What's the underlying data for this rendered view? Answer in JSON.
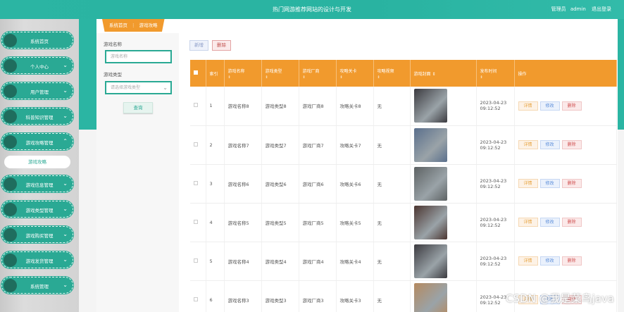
{
  "header": {
    "title": "热门网游推荐网站的设计与开发",
    "user_role": "管理员",
    "username": "admin",
    "logout": "退出登录"
  },
  "sidebar": {
    "items": [
      {
        "label": "系统首页",
        "chevron": ""
      },
      {
        "label": "个人中心",
        "chevron": "⌄"
      },
      {
        "label": "用户管理",
        "chevron": "⌄"
      },
      {
        "label": "科普知识管理",
        "chevron": "⌄"
      },
      {
        "label": "游戏攻略管理",
        "chevron": "⌃"
      },
      {
        "label": "游戏信息管理",
        "chevron": "⌄"
      },
      {
        "label": "游戏类型管理",
        "chevron": "⌄"
      },
      {
        "label": "游戏购买管理",
        "chevron": "⌄"
      },
      {
        "label": "游戏发货管理",
        "chevron": "⌄"
      },
      {
        "label": "系统管理",
        "chevron": "⌄"
      }
    ],
    "active_sub": "游戏攻略"
  },
  "breadcrumb": {
    "home": "系统首页",
    "sep": "⋮",
    "current": "游戏攻略"
  },
  "filter": {
    "name_label": "游戏名称",
    "name_placeholder": "游戏名称",
    "type_label": "游戏类型",
    "type_placeholder": "请选择游戏类型",
    "search": "查询"
  },
  "toolbar": {
    "add": "新增",
    "delete": "删除"
  },
  "table": {
    "headers": [
      "索引",
      "游戏名称",
      "游戏类型",
      "游戏厂商",
      "攻略关卡",
      "攻略视频",
      "游戏封面",
      "发布时间",
      "操作"
    ],
    "sort_glyph": "⇕",
    "rows": [
      {
        "idx": "1",
        "name": "游戏名称8",
        "type": "游戏类型8",
        "vendor": "游戏厂商8",
        "level": "攻略关卡8",
        "video": "无",
        "time": "2023-04-23 09:12:52",
        "cover": "#3b3a3f"
      },
      {
        "idx": "2",
        "name": "游戏名称7",
        "type": "游戏类型7",
        "vendor": "游戏厂商7",
        "level": "攻略关卡7",
        "video": "无",
        "time": "2023-04-23 09:12:52",
        "cover": "#5a6f8c"
      },
      {
        "idx": "3",
        "name": "游戏名称6",
        "type": "游戏类型6",
        "vendor": "游戏厂商6",
        "level": "攻略关卡6",
        "video": "无",
        "time": "2023-04-23 09:12:52",
        "cover": "#5d6263"
      },
      {
        "idx": "4",
        "name": "游戏名称5",
        "type": "游戏类型5",
        "vendor": "游戏厂商5",
        "level": "攻略关卡5",
        "video": "无",
        "time": "2023-04-23 09:12:52",
        "cover": "#4b3530"
      },
      {
        "idx": "5",
        "name": "游戏名称4",
        "type": "游戏类型4",
        "vendor": "游戏厂商4",
        "level": "攻略关卡4",
        "video": "无",
        "time": "2023-04-23 09:12:52",
        "cover": "#3b3a3f"
      },
      {
        "idx": "6",
        "name": "游戏名称3",
        "type": "游戏类型3",
        "vendor": "游戏厂商3",
        "level": "攻略关卡3",
        "video": "无",
        "time": "2023-04-23 09:12:52",
        "cover": "#b58a60"
      }
    ],
    "ops": {
      "detail": "详情",
      "edit": "修改",
      "delete": "删除"
    }
  },
  "watermark": "CSDN @我是菜鸟java",
  "colors": {
    "teal": "#2bb5a3",
    "orange": "#f19a2d"
  }
}
